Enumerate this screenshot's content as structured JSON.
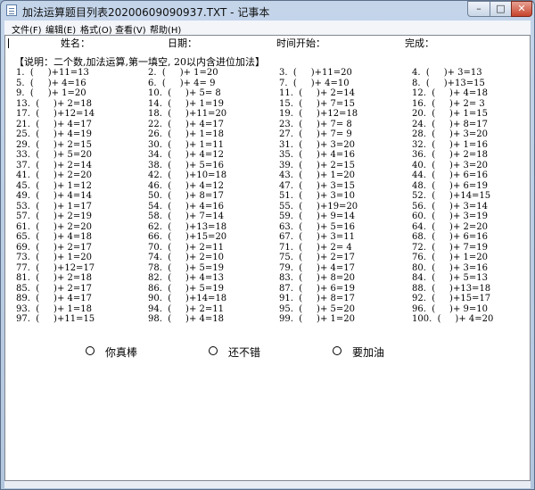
{
  "window": {
    "title": "加法运算题目列表20200609090937.TXT - 记事本"
  },
  "controls": {
    "minimize": "–",
    "maximize": "□",
    "close": "✕"
  },
  "menu": [
    "文件(F)",
    "编辑(E)",
    "格式(O)",
    "查看(V)",
    "帮助(H)"
  ],
  "header": {
    "name_label": "姓名：",
    "date_label": "日期：",
    "start_label": "时间开始：",
    "end_label": "完成："
  },
  "instruction": "【说明：二个数,加法运算,第一填空, 20以内含进位加法】",
  "problems": [
    "1.  (     )+11=13",
    "2.  (     )+ 1=20",
    "3.  (     )+11=20",
    "4.  (     )+ 3=13",
    "5.  (     )+ 4=16",
    "6.  (     )+ 4= 9",
    "7.  (     )+ 4=10",
    "8.  (     )+13=15",
    "9.  (     )+ 1=20",
    "10.  (     )+ 5= 8",
    "11.  (     )+ 2=14",
    "12.  (     )+ 4=18",
    "13.  (     )+ 2=18",
    "14.  (     )+ 1=19",
    "15.  (     )+ 7=15",
    "16.  (     )+ 2= 3",
    "17.  (     )+12=14",
    "18.  (     )+11=20",
    "19.  (     )+12=18",
    "20.  (     )+ 1=15",
    "21.  (     )+ 4=17",
    "22.  (     )+ 4=17",
    "23.  (     )+ 7= 8",
    "24.  (     )+ 8=17",
    "25.  (     )+ 4=19",
    "26.  (     )+ 1=18",
    "27.  (     )+ 7= 9",
    "28.  (     )+ 3=20",
    "29.  (     )+ 2=15",
    "30.  (     )+ 1=11",
    "31.  (     )+ 3=20",
    "32.  (     )+ 1=16",
    "33.  (     )+ 5=20",
    "34.  (     )+ 4=12",
    "35.  (     )+ 4=16",
    "36.  (     )+ 2=18",
    "37.  (     )+ 2=14",
    "38.  (     )+ 5=16",
    "39.  (     )+ 2=15",
    "40.  (     )+ 3=20",
    "41.  (     )+ 2=20",
    "42.  (     )+10=18",
    "43.  (     )+ 1=20",
    "44.  (     )+ 6=16",
    "45.  (     )+ 1=12",
    "46.  (     )+ 4=12",
    "47.  (     )+ 3=15",
    "48.  (     )+ 6=19",
    "49.  (     )+ 4=14",
    "50.  (     )+ 8=17",
    "51.  (     )+ 3=10",
    "52.  (     )+14=15",
    "53.  (     )+ 1=17",
    "54.  (     )+ 4=16",
    "55.  (     )+19=20",
    "56.  (     )+ 3=14",
    "57.  (     )+ 2=19",
    "58.  (     )+ 7=14",
    "59.  (     )+ 9=14",
    "60.  (     )+ 3=19",
    "61.  (     )+ 2=20",
    "62.  (     )+13=18",
    "63.  (     )+ 5=16",
    "64.  (     )+ 2=20",
    "65.  (     )+ 4=18",
    "66.  (     )+15=20",
    "67.  (     )+ 3=11",
    "68.  (     )+ 6=16",
    "69.  (     )+ 2=17",
    "70.  (     )+ 2=11",
    "71.  (     )+ 2= 4",
    "72.  (     )+ 7=19",
    "73.  (     )+ 1=20",
    "74.  (     )+ 2=10",
    "75.  (     )+ 2=17",
    "76.  (     )+ 1=20",
    "77.  (     )+12=17",
    "78.  (     )+ 5=19",
    "79.  (     )+ 4=17",
    "80.  (     )+ 3=16",
    "81.  (     )+ 2=18",
    "82.  (     )+ 4=13",
    "83.  (     )+ 8=20",
    "84.  (     )+ 5=13",
    "85.  (     )+ 2=17",
    "86.  (     )+ 5=19",
    "87.  (     )+ 6=19",
    "88.  (     )+13=18",
    "89.  (     )+ 4=17",
    "90.  (     )+14=18",
    "91.  (     )+ 8=17",
    "92.  (     )+15=17",
    "93.  (     )+ 1=18",
    "94.  (     )+ 2=11",
    "95.  (     )+ 5=20",
    "96.  (     )+ 9=10",
    "97.  (     )+11=15",
    "98.  (     )+ 4=18",
    "99.  (     )+ 1=20",
    "100.  (     )+ 4=20"
  ],
  "ratings": [
    {
      "label": "你真棒"
    },
    {
      "label": "还不错"
    },
    {
      "label": "要加油"
    }
  ]
}
